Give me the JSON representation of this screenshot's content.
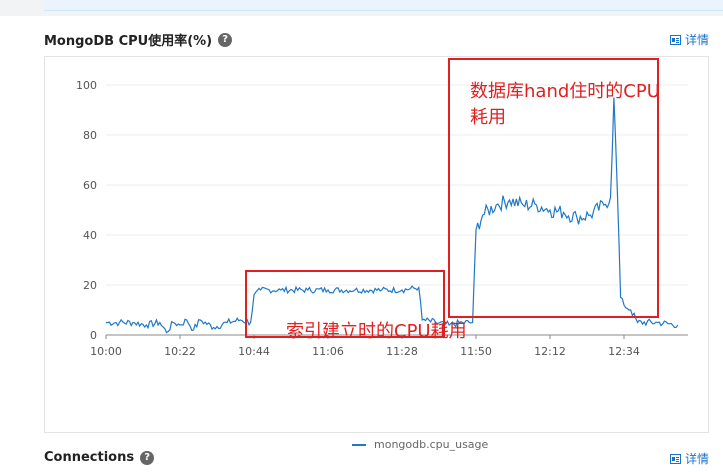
{
  "panel": {
    "title": "MongoDB CPU使用率(%)",
    "help_icon": "question-circle-icon",
    "detail_label": "详情",
    "detail_icon": "detail-list-icon"
  },
  "next_panel": {
    "title": "Connections",
    "detail_label": "详情"
  },
  "annotations": {
    "index_build": "索引建立时的CPU耗用",
    "hang_line1": "数据库hand住时的CPU",
    "hang_line2": "耗用"
  },
  "colors": {
    "series": "#1f78c8",
    "annotation": "#e02020",
    "link": "#1a73c9"
  },
  "chart_data": {
    "type": "line",
    "ylim": [
      0,
      100
    ],
    "yticks": [
      "0",
      "20",
      "40",
      "60",
      "80",
      "100"
    ],
    "xticks": [
      "10:00",
      "10:22",
      "10:44",
      "11:06",
      "11:28",
      "11:50",
      "12:12",
      "12:34"
    ],
    "legend": "mongodb.cpu_usage",
    "legend_position": "bottom-center",
    "grid": true,
    "series": [
      {
        "name": "mongodb.cpu_usage",
        "points": [
          [
            "10:00",
            5
          ],
          [
            "10:04",
            5
          ],
          [
            "10:08",
            5
          ],
          [
            "10:12",
            4
          ],
          [
            "10:16",
            5
          ],
          [
            "10:18",
            1
          ],
          [
            "10:20",
            5
          ],
          [
            "10:22",
            4
          ],
          [
            "10:24",
            6
          ],
          [
            "10:26",
            2
          ],
          [
            "10:28",
            6
          ],
          [
            "10:32",
            3
          ],
          [
            "10:36",
            5
          ],
          [
            "10:40",
            6
          ],
          [
            "10:43",
            5
          ],
          [
            "10:44",
            16
          ],
          [
            "10:46",
            18
          ],
          [
            "10:52",
            18
          ],
          [
            "11:00",
            18
          ],
          [
            "11:06",
            18
          ],
          [
            "11:14",
            18
          ],
          [
            "11:22",
            18
          ],
          [
            "11:28",
            18
          ],
          [
            "11:33",
            19
          ],
          [
            "11:34",
            6
          ],
          [
            "11:38",
            5
          ],
          [
            "11:42",
            4
          ],
          [
            "11:46",
            5
          ],
          [
            "11:49",
            5
          ],
          [
            "11:50",
            42
          ],
          [
            "11:52",
            48
          ],
          [
            "11:56",
            52
          ],
          [
            "12:00",
            54
          ],
          [
            "12:04",
            52
          ],
          [
            "12:08",
            52
          ],
          [
            "12:12",
            50
          ],
          [
            "12:16",
            49
          ],
          [
            "12:20",
            47
          ],
          [
            "12:24",
            48
          ],
          [
            "12:28",
            52
          ],
          [
            "12:30",
            55
          ],
          [
            "12:31",
            95
          ],
          [
            "12:32",
            58
          ],
          [
            "12:33",
            15
          ],
          [
            "12:34",
            12
          ],
          [
            "12:36",
            10
          ],
          [
            "12:38",
            5
          ],
          [
            "12:44",
            5
          ],
          [
            "12:50",
            4
          ]
        ]
      }
    ]
  }
}
